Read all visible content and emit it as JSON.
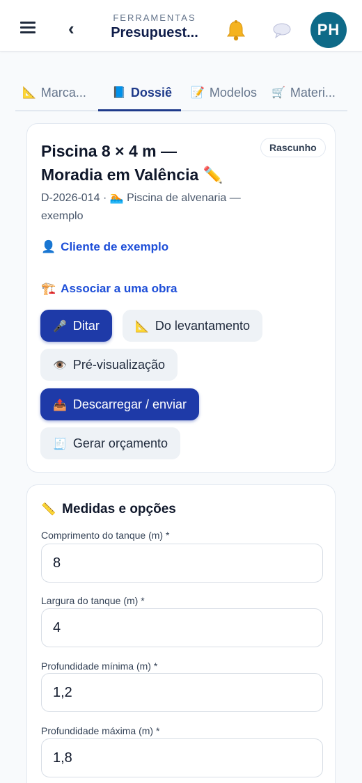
{
  "header": {
    "eyebrow": "FERRAMENTAS",
    "title": "Presupuest...",
    "avatar_initials": "PH",
    "icons": [
      "menu-icon",
      "back-arrow-icon",
      "bell-icon",
      "chat-bubble-icon"
    ]
  },
  "tabs": [
    {
      "icon": "📐",
      "label": "Marca...",
      "active": false
    },
    {
      "icon": "📘",
      "label": "Dossiê",
      "active": true
    },
    {
      "icon": "📝",
      "label": "Modelos",
      "active": false
    },
    {
      "icon": "🛒",
      "label": "Materi...",
      "active": false
    }
  ],
  "dossier": {
    "title_line1": "Piscina 8 × 4 m —",
    "title_line2": "Moradia em Valência",
    "title_emoji": "✏️",
    "status_badge": "Rascunho",
    "code": "D-2026-014 · ",
    "type_icon": "🏊",
    "type": "Piscina de alvenaria —",
    "type_cont": "exemplo",
    "client": {
      "icon": "👤",
      "label": "Cliente de exemplo"
    },
    "associate": {
      "icon": "🏗️",
      "label": "Associar a uma obra"
    },
    "buttons": {
      "dictate": {
        "icon": "🎤",
        "label": "Ditar"
      },
      "from_survey": {
        "icon": "📐",
        "label": "Do levantamento"
      },
      "preview": {
        "icon": "👁️",
        "label": "Pré-visualização"
      },
      "download": {
        "icon": "📤",
        "label": "Descarregar / enviar"
      },
      "quote": {
        "icon": "🧾",
        "label": "Gerar orçamento"
      }
    }
  },
  "measures": {
    "icon": "📏",
    "title": "Medidas e opções",
    "fields": [
      {
        "label": "Comprimento do tanque (m) *",
        "value": "8"
      },
      {
        "label": "Largura do tanque (m) *",
        "value": "4"
      },
      {
        "label": "Profundidade mínima (m) *",
        "value": "1,2"
      },
      {
        "label": "Profundidade máxima (m) *",
        "value": "1,8"
      }
    ]
  },
  "colors": {
    "primary": "#1e3aa8",
    "link": "#1d4ed8",
    "avatar": "#0e6a88",
    "header_title": "#0f1d4a"
  }
}
